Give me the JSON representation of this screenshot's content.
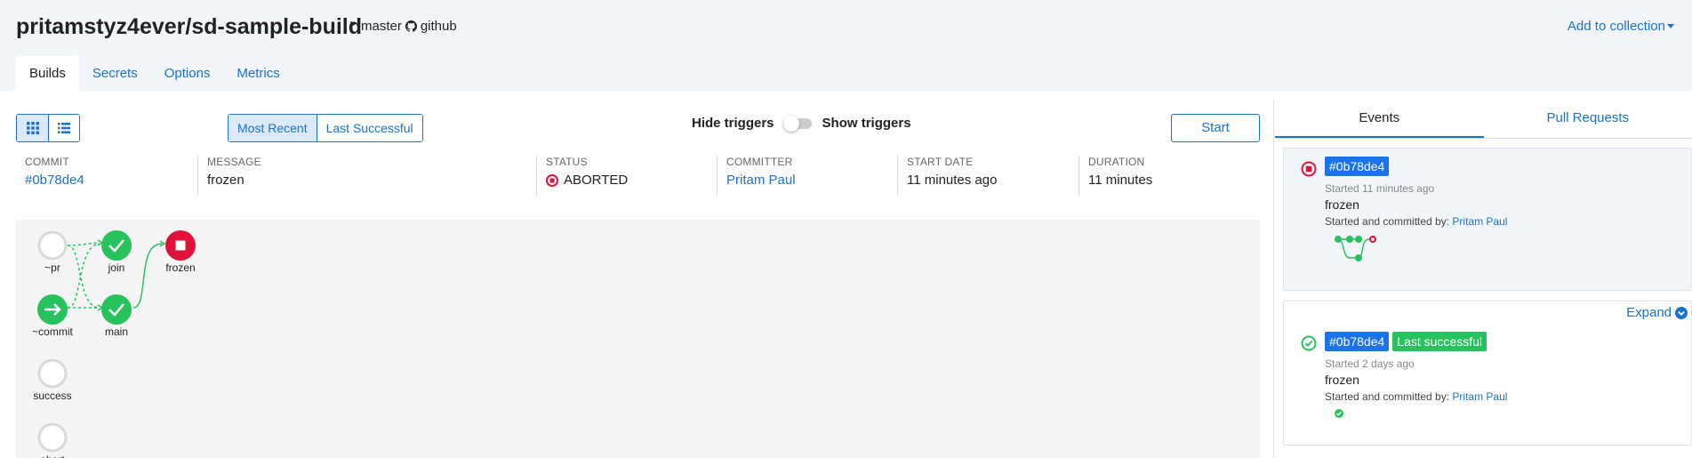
{
  "repo": {
    "title": "pritamstyz4ever/sd-sample-build",
    "branch": "master",
    "scm": "github",
    "add_collection": "Add to collection"
  },
  "tabs": [
    "Builds",
    "Secrets",
    "Options",
    "Metrics"
  ],
  "view_toggle": {
    "active": "graph"
  },
  "sort": {
    "most_recent": "Most Recent",
    "last_successful": "Last Successful"
  },
  "triggers": {
    "hide": "Hide triggers",
    "show": "Show triggers"
  },
  "start_label": "Start",
  "build": {
    "commit_label": "COMMIT",
    "commit": "#0b78de4",
    "message_label": "MESSAGE",
    "message": "frozen",
    "status_label": "STATUS",
    "status": "ABORTED",
    "committer_label": "COMMITTER",
    "committer": "Pritam Paul",
    "start_label": "START DATE",
    "start": "11 minutes ago",
    "duration_label": "DURATION",
    "duration": "11 minutes"
  },
  "graph": {
    "nodes": [
      {
        "id": "pr",
        "label": "~pr",
        "state": "none"
      },
      {
        "id": "join",
        "label": "join",
        "state": "success"
      },
      {
        "id": "frozen",
        "label": "frozen",
        "state": "aborted"
      },
      {
        "id": "commit",
        "label": "~commit",
        "state": "trigger"
      },
      {
        "id": "main",
        "label": "main",
        "state": "success"
      },
      {
        "id": "success",
        "label": "success",
        "state": "none"
      },
      {
        "id": "abort",
        "label": "abort",
        "state": "none"
      }
    ]
  },
  "panel": {
    "tabs": [
      "Events",
      "Pull Requests"
    ],
    "events": [
      {
        "sha": "#0b78de4",
        "status": "aborted",
        "started": "Started 11 minutes ago",
        "message": "frozen",
        "by_prefix": "Started and committed by:",
        "by": "Pritam Paul"
      },
      {
        "sha": "#0b78de4",
        "status": "success",
        "tag": "Last successful",
        "started": "Started 2 days ago",
        "message": "frozen",
        "by_prefix": "Started and committed by:",
        "by": "Pritam Paul",
        "expand": "Expand"
      }
    ]
  },
  "colors": {
    "accent": "#1a73c9",
    "success": "#27c25d",
    "aborted": "#e0123a",
    "sha_tag": "#1a73e8"
  }
}
